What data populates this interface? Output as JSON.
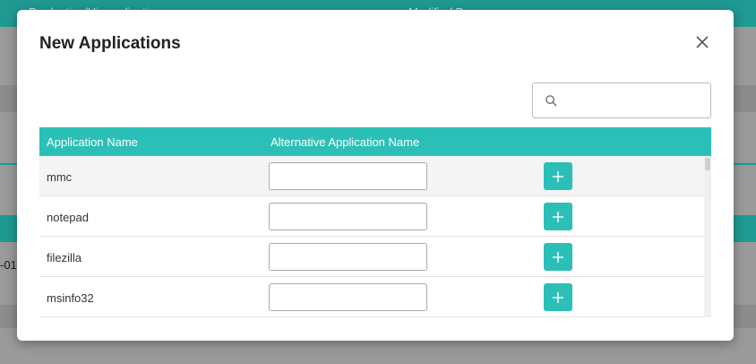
{
  "background": {
    "header_col1": "Production/Hiera...lication",
    "header_col2": "Modified D...",
    "row_fragment": "-01"
  },
  "modal": {
    "title": "New Applications",
    "search": {
      "value": "",
      "placeholder": ""
    },
    "columns": [
      "Application Name",
      "Alternative Application Name"
    ],
    "rows": [
      {
        "name": "mmc",
        "alt_value": ""
      },
      {
        "name": "notepad",
        "alt_value": ""
      },
      {
        "name": "filezilla",
        "alt_value": ""
      },
      {
        "name": "msinfo32",
        "alt_value": ""
      }
    ],
    "icons": {
      "close": "close-icon",
      "search": "search-icon",
      "add": "plus-icon"
    }
  },
  "colors": {
    "accent": "#2bbfb7",
    "dark_accent": "#1f9a93"
  }
}
